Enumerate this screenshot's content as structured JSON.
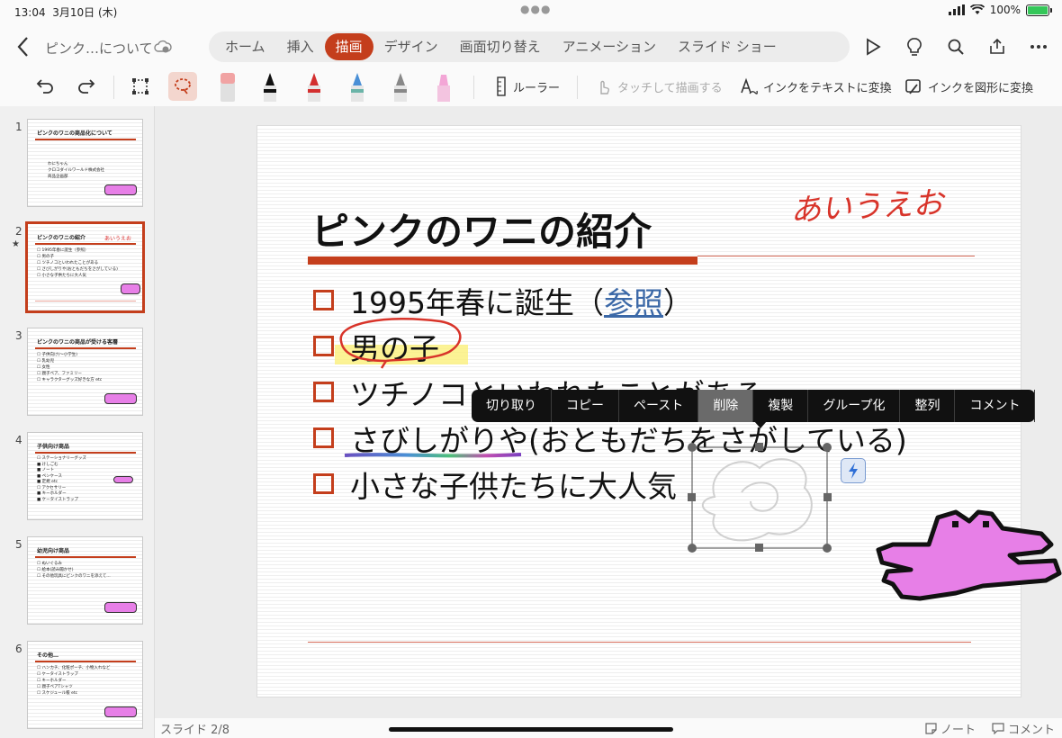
{
  "status": {
    "time": "13:04",
    "date": "3月10日 (木)",
    "battery": "100%"
  },
  "title": {
    "doc_name": "ピンク…について"
  },
  "tabs": [
    {
      "label": "ホーム"
    },
    {
      "label": "挿入"
    },
    {
      "label": "描画"
    },
    {
      "label": "デザイン"
    },
    {
      "label": "画面切り替え"
    },
    {
      "label": "アニメーション"
    },
    {
      "label": "スライド ショー"
    }
  ],
  "toolbar": {
    "ruler": "ルーラー",
    "touch_draw": "タッチして描画する",
    "ink_to_text": "インクをテキストに変換",
    "ink_to_shape": "インクを図形に変換"
  },
  "thumbnails": [
    {
      "num": "1",
      "title": "ピンクのワニの商品化について",
      "lines": [
        "わにちゃん",
        "クロコダイルワールド株式会社",
        "商品企画部"
      ]
    },
    {
      "num": "2",
      "title": "ピンクのワニの紹介",
      "hand": "あいうえお",
      "lines": [
        "☐ 1995年春に誕生（参照）",
        "☐ 男の子",
        "☐ ツチノコといわれたことがある",
        "☐ さびしがりや(おともだちをさがしている)",
        "☐ 小さな子供たちに大人気"
      ]
    },
    {
      "num": "3",
      "title": "ピンクのワニの商品が受ける客層",
      "lines": [
        "☐ 子供向け(～小学生)",
        "☐ 乳幼児",
        "☐ 女性",
        "☐ 親子ペア、ファミリー",
        "☐ キャラクターグッズ好きな方 etc"
      ]
    },
    {
      "num": "4",
      "title": "子供向け商品",
      "lines": [
        "☐ ステーショナリーグッズ",
        "  ■ けしごむ",
        "  ■ ノート",
        "  ■ ペンケース",
        "  ■ 定規 etc",
        "☐ アクセサリー",
        "  ■ キーホルダー",
        "  ■ ケータイストラップ"
      ]
    },
    {
      "num": "5",
      "title": "幼児向け商品",
      "lines": [
        "☐ ぬいぐるみ",
        "☐ 絵本(読み聞かせ)",
        "☐ その他玩具にピンクのワニを添えて…"
      ]
    },
    {
      "num": "6",
      "title": "その他…",
      "lines": [
        "☐ ハンカチ、化粧ポーチ、小物入れなど",
        "☐ ケータイストラップ",
        "☐ キーホルダー",
        "☐ 親子ペアTシャツ",
        "☐ スケジュール帳 etc"
      ]
    }
  ],
  "slide": {
    "title": "ピンクのワニの紹介",
    "handwriting": "あいうえお",
    "bullet1_pre": "1995年春に誕生（",
    "bullet1_link": "参照",
    "bullet1_post": "）",
    "bullet2": "男の子",
    "bullet3": "ツチノコといわれたことがある",
    "bullet4": "さびしがりや(おともだちをさがしている)",
    "bullet5": "小さな子供たちに大人気"
  },
  "context_menu": [
    "切り取り",
    "コピー",
    "ペースト",
    "削除",
    "複製",
    "グループ化",
    "整列",
    "コメント"
  ],
  "bottom": {
    "slide_count": "スライド 2/8",
    "notes": "ノート",
    "comments": "コメント"
  },
  "colors": {
    "accent": "#c43e1c",
    "croc_pink": "#e77fe7",
    "link": "#3b68a7"
  }
}
